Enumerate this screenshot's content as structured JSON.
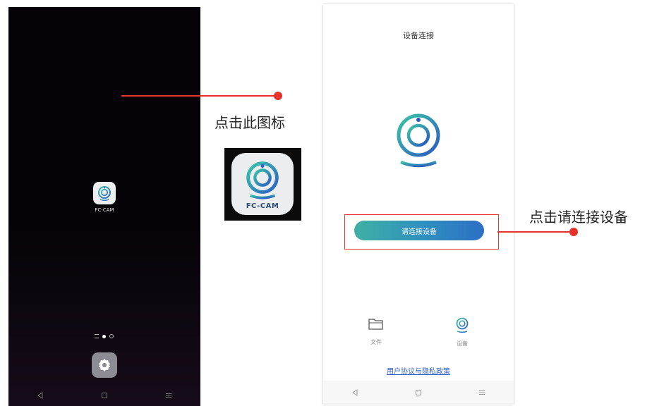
{
  "home_screen": {
    "app_label": "FC-CAM"
  },
  "annotations": {
    "click_icon_text": "点击此图标",
    "click_connect_text": "点击请连接设备"
  },
  "big_icon": {
    "label": "FC-CAM"
  },
  "app_screen": {
    "title": "设备连接",
    "connect_button": "请连接设备",
    "tabs": [
      {
        "label": "文件",
        "icon": "folder-icon"
      },
      {
        "label": "设备",
        "icon": "camera-device-icon"
      }
    ],
    "policy_link": "用户协议与隐私政策"
  },
  "colors": {
    "annotation_red": "#e5322d",
    "button_gradient_start": "#3fb0a4",
    "button_gradient_end": "#2d6fc4",
    "link_blue": "#2f5cc8"
  }
}
